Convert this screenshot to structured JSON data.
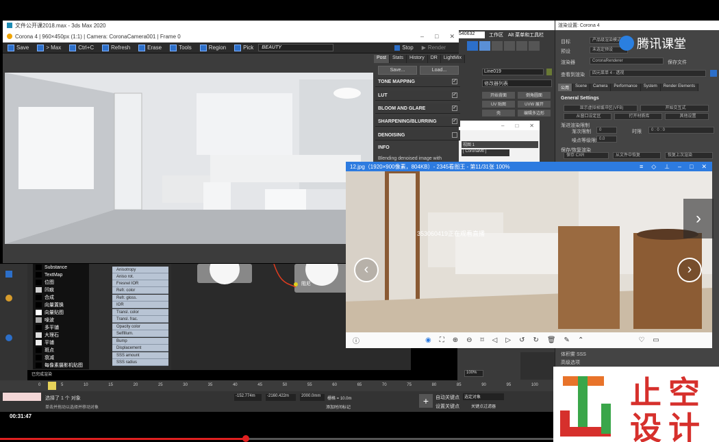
{
  "max_window": {
    "title": "文件公开课2018.max - 3ds Max 2020"
  },
  "vfb": {
    "title": "Corona 4 | 960×450px (1:1) | Camera: CoronaCamera001 | Frame 0",
    "toolbar": [
      "Save",
      "> Max",
      "Ctrl+C",
      "Refresh",
      "Erase",
      "Tools",
      "Region",
      "Pick"
    ],
    "render_element": "BEAUTY",
    "stop_label": "Stop",
    "render_label": "Render",
    "tabs": [
      "Post",
      "Stats",
      "History",
      "DR",
      "LightMix"
    ],
    "save_btn": "Save...",
    "load_btn": "Load...",
    "sections": [
      {
        "label": "TONE MAPPING",
        "checked": "✓"
      },
      {
        "label": "LUT",
        "checked": "✓"
      },
      {
        "label": "BLOOM AND GLARE",
        "checked": "✓"
      },
      {
        "label": "SHARPENING/BLURRING",
        "checked": "✓"
      },
      {
        "label": "DENOISING",
        "checked": ""
      }
    ],
    "info_label": "INFO",
    "info_text": "Blending denoised image with"
  },
  "max_right": {
    "counter": "540632",
    "workspace": "工作区",
    "alt_menu": "Alt 菜单和工具栏",
    "field1": "Line019",
    "modifier_list": "修改器列表",
    "btns": [
      "开始背面",
      "倒角圆面",
      "UV 贴图",
      "UVW 展开",
      "壳",
      "编辑多边形"
    ]
  },
  "float_window": {
    "item": "视图 1",
    "sub": "[ CoronaMtl ]"
  },
  "render_setup": {
    "title": "渲染设置: Corona 4",
    "target_label": "目标",
    "target_value": "产品级渲染模式",
    "preset_label": "预设",
    "preset_value": "未选定预设",
    "renderer_label": "渲染器",
    "renderer_value": "CoronaRenderer",
    "save_file": "保存文件",
    "view_label": "查看到渲染",
    "view_value": "四元菜单 4 - 透视",
    "tabs": [
      "公用",
      "Scene",
      "Camera",
      "Performance",
      "System",
      "Render Elements"
    ],
    "general": "General Settings",
    "btn1": "显示虚拟帧缓冲区(VFB)",
    "btn2": "开始交互式",
    "btn3": "从窗口设定区",
    "btn4": "打开材质库",
    "btn5": "其他设置",
    "limit_label": "渐进渲染限制",
    "pass_label": "渐次限制",
    "time_label": "时限",
    "noise_label": "噪点等级限制",
    "save_label": "保存/恢复渲染",
    "save_cxr": "保存 CXR",
    "restore": "从文件中恢复",
    "restore_last": "恢复上次渲染",
    "misc": "体积雾 SSS",
    "opts": "高级选项"
  },
  "watermark": "腾讯课堂",
  "viewer": {
    "title": "12.jpg（1920×900像素，804KB）- 2345看图王 - 第11/31张 100%",
    "overlay": "353060419正在观看直播"
  },
  "material_list": [
    "Substance",
    "TextMap",
    "位图",
    "凹痕",
    "合成",
    "向量置换",
    "向量贴图",
    "噪波",
    "多平铺",
    "大理石",
    "平铺",
    "斑点",
    "衰减",
    "每像素摄影机贴图"
  ],
  "slots": [
    "Anisotropy",
    "Aniso rot.",
    "Fresnel IOR",
    "Refr. color",
    "Refr. gloss.",
    "IOR",
    "Transl. color",
    "Transl. frac.",
    "Opacity color",
    "SelfIllum.",
    "Bump",
    "Displacement",
    "SSS amount",
    "SSS radius"
  ],
  "node_label": "阻尼",
  "zoom": "100%",
  "timeline_ticks": [
    "0",
    "5",
    "10",
    "15",
    "20",
    "25",
    "30",
    "35",
    "40",
    "45",
    "50",
    "55",
    "60",
    "65",
    "70",
    "75",
    "80",
    "85",
    "90",
    "95",
    "100"
  ],
  "status": {
    "selected": "选择了 1 个 对象",
    "x": "-152.774m",
    "y": "-2160.422m",
    "z": "2000.0mm",
    "grid": "栅格 = 10.0m",
    "autokey": "自动关键点",
    "select_obj": "选定对象",
    "setkey": "设置关键点",
    "add_time": "添加时间标记",
    "hint": "单击并拖动以选择并移动对象",
    "filter": "关键点过滤器",
    "mini": "已完成渲染"
  },
  "video": {
    "time": "00:31:47"
  },
  "logo": {
    "line1": "止空",
    "line2": "设计",
    "colors": {
      "orange": "#e8732a",
      "green": "#3aa64a",
      "red": "#d6302c",
      "brand": "#d6302c"
    }
  }
}
